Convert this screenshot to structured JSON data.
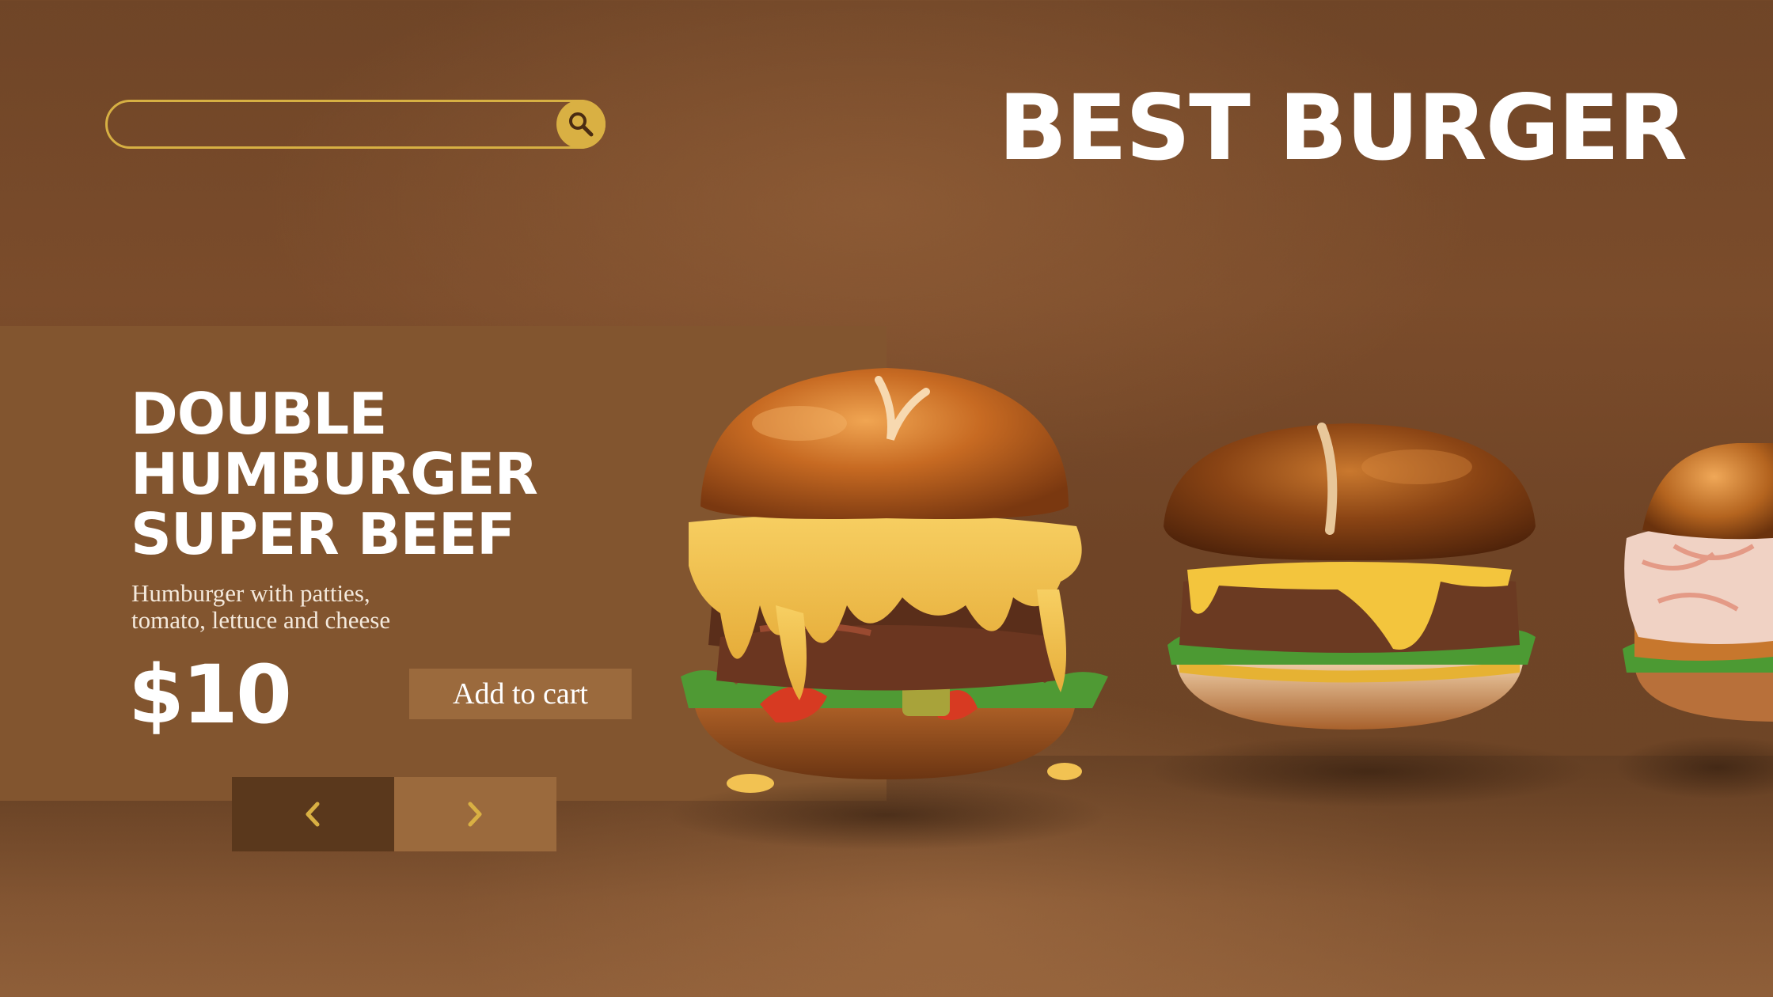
{
  "search": {
    "value": "",
    "placeholder": ""
  },
  "header": {
    "title": "BEST BURGER"
  },
  "product": {
    "title_lines": [
      "DOUBLE",
      "HUMBURGER",
      "SUPER BEEF"
    ],
    "description_lines": [
      "Humburger with patties,",
      "tomato, lettuce and cheese"
    ],
    "price": "$10",
    "add_to_cart_label": "Add to cart"
  },
  "carousel": {
    "prev_icon": "chevron-left-icon",
    "next_icon": "chevron-right-icon",
    "items": [
      "double-cheese-burger",
      "cheeseburger",
      "chicken-slaw-burger"
    ]
  },
  "colors": {
    "accent": "#d9b043",
    "card": "#82552f",
    "button": "#9b6a3d",
    "nav_dark": "#5a381c",
    "background": "#6f4527"
  }
}
